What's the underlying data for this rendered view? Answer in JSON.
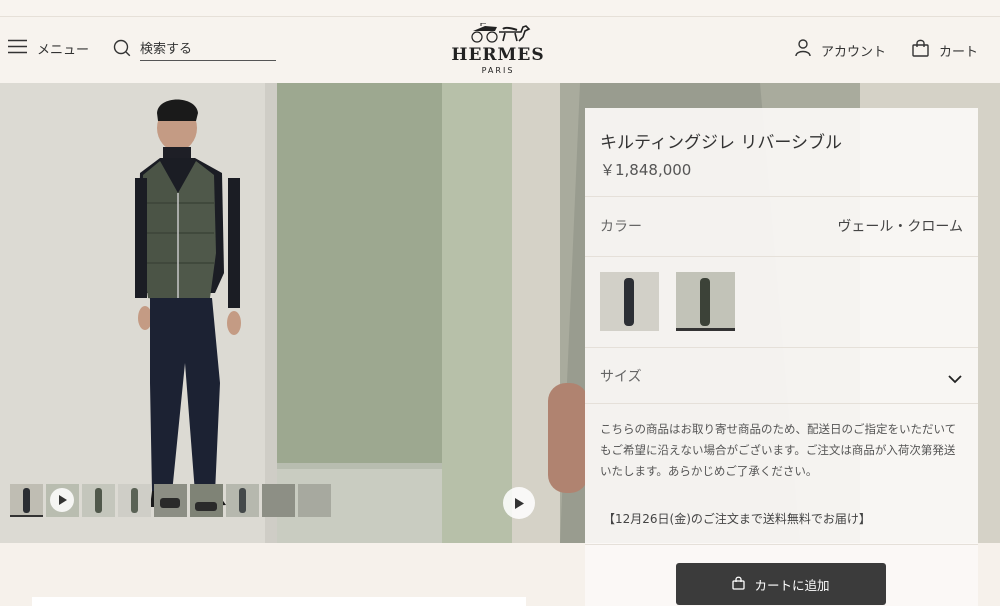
{
  "header": {
    "menu_label": "メニュー",
    "search_placeholder": "検索する",
    "brand": "HERMES",
    "brand_city": "PARIS",
    "account_label": "アカウント",
    "cart_label": "カート"
  },
  "gallery": {
    "thumbnail_count": 9,
    "active_thumbnail": 1
  },
  "product": {
    "title": "キルティングジレ リバーシブル",
    "price": "￥1,848,000",
    "color_label": "カラー",
    "color_value": "ヴェール・クローム",
    "swatches_count": 2,
    "selected_swatch": 2,
    "size_label": "サイズ",
    "note": "こちらの商品はお取り寄せ商品のため、配送日のご指定をいただいてもご希望に沿えない場合がございます。ご注文は商品が入荷次第発送いたします。あらかじめご了承ください。",
    "shipping_notice": "【12月26日(金)のご注文まで送料無料でお届け】",
    "add_to_cart_label": "カートに追加"
  },
  "colors": {
    "background": "#f6f1eb",
    "button": "#3b3b3b",
    "wall_green": "#9aa58e"
  },
  "icons": [
    "menu-icon",
    "search-icon",
    "horse-carriage-logo",
    "account-icon",
    "bag-icon",
    "play-icon",
    "chevron-down-icon"
  ]
}
